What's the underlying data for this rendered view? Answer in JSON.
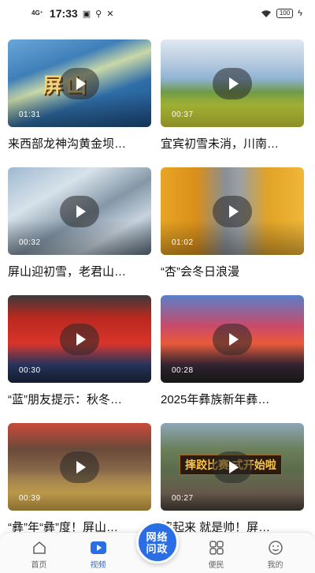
{
  "status_bar": {
    "signal": "4G⁺",
    "time": "17:33",
    "battery": "100"
  },
  "videos": [
    {
      "title": "来西部龙神沟黄金坝…",
      "duration": "01:31",
      "overlay_text": "屏山",
      "banner": ""
    },
    {
      "title": "宜宾初雪未消，川南…",
      "duration": "00:37",
      "overlay_text": "",
      "banner": ""
    },
    {
      "title": "屏山迎初雪，老君山…",
      "duration": "00:32",
      "overlay_text": "",
      "banner": ""
    },
    {
      "title": "“杏”会冬日浪漫",
      "duration": "01:02",
      "overlay_text": "",
      "banner": ""
    },
    {
      "title": "“蓝”朋友提示：秋冬…",
      "duration": "00:30",
      "overlay_text": "",
      "banner": ""
    },
    {
      "title": "2025年彝族新年彝…",
      "duration": "00:28",
      "overlay_text": "",
      "banner": ""
    },
    {
      "title": "“彝”年“彝”度！屏山…",
      "duration": "00:39",
      "overlay_text": "",
      "banner": ""
    },
    {
      "title": "摔起来 就是帅！屏…",
      "duration": "00:27",
      "overlay_text": "",
      "banner": "摔跤比赛 式开始啦"
    }
  ],
  "tab_bar": {
    "home": "首页",
    "video": "视频",
    "center": "网络问政",
    "services": "便民",
    "mine": "我的"
  },
  "colors": {
    "accent": "#2a6ee6"
  }
}
